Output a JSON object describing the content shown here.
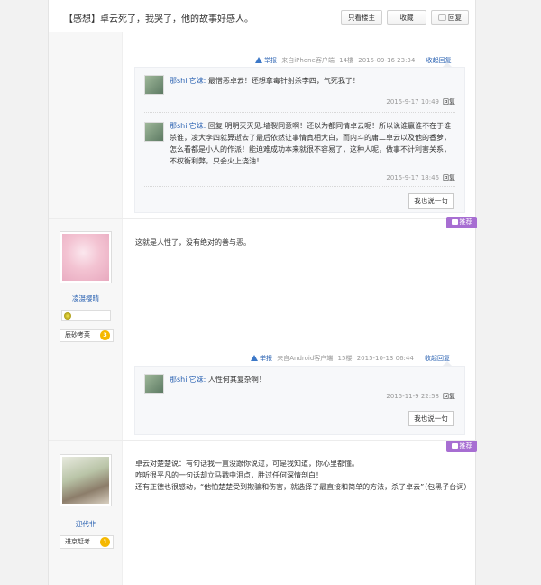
{
  "header": {
    "title": "【感想】卓云死了，我哭了，他的故事好感人。",
    "btn_only_op": "只看楼主",
    "btn_fav": "收藏",
    "btn_reply": "回复"
  },
  "post1": {
    "report": "举报",
    "source": "来自iPhone客户端",
    "floor": "14楼",
    "time": "2015-09-16 23:34",
    "collapse": "收起回复",
    "replies": [
      {
        "user": "那shi'它妹:",
        "text": "最憎恶卓云！还想拿毒针射杀李四，气死我了！",
        "time": "2015-9-17 10:49",
        "reply": "回复"
      },
      {
        "user": "那shi'它妹:",
        "text": "回复 明明灭灭见:墙裂同意啊！还以为都同情卓云呢！所以说谁赢谁不在于谁杀谁，凌大李四就算逝去了最后依然让事情真相大白，而内斗的庸二卓云以及他的香萝，怎么看都是小人的作派！能迫难成功本来就很不容易了，这种人呢，做事不计利害关系，不权衡利弊，只会火上浇油！",
        "time": "2015-9-17 18:46",
        "reply": "回复"
      }
    ],
    "say_btn": "我也说一句"
  },
  "post2": {
    "tuijian": "推荐",
    "username": "凌滠樱晴",
    "level_name": "辰砂考莱",
    "level_num": "3",
    "content": "这就是人性了，没有绝对的善与恶。",
    "report": "举报",
    "source": "来自Android客户端",
    "floor": "15楼",
    "time": "2015-10-13 06:44",
    "collapse": "收起回复",
    "replies": [
      {
        "user": "那shi'它妹:",
        "text": "人性何其复杂啊！",
        "time": "2015-11-9 22:58",
        "reply": "回复"
      }
    ],
    "say_btn": "我也说一句"
  },
  "post3": {
    "tuijian": "推荐",
    "username": "迎代非",
    "level_name": "进京赶考",
    "level_num": "1",
    "lines": [
      "卓云对楚楚说：有句话我一直没跟你说过，可是我知道，你心里都懂。",
      "咋听很平凡的一句话却立马戳中泪点，胜过任何深情剖白！",
      "还有正德也很感动，“他怕楚楚受到欺骗和伤害，就选择了最直接和简单的方法，杀了卓云”（包黑子台词）"
    ]
  },
  "colors": {
    "link": "#2d64b3",
    "tuijian": "#a76ed2",
    "level_badge": "#f5b800"
  }
}
